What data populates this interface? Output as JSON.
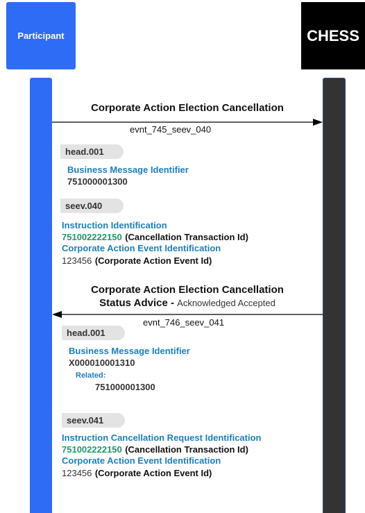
{
  "actors": {
    "participant": "Participant",
    "chess": "CHESS"
  },
  "message1": {
    "title": "Corporate Action Election Cancellation",
    "event": "evnt_745_seev_040",
    "head": {
      "tag": "head.001",
      "field": "Business Message Identifier",
      "value": "751000001300"
    },
    "body": {
      "tag": "seev.040",
      "f1": "Instruction Identification",
      "v1_id": "751002222150",
      "v1_note": "(Cancellation Transaction Id)",
      "f2": "Corporate Action Event Identification",
      "v2_id": "123456",
      "v2_note": "(Corporate Action Event Id)"
    }
  },
  "message2": {
    "title_line1": "Corporate Action Election Cancellation",
    "title_line2": "Status Advice -",
    "status": "Acknowledged Accepted",
    "event": "evnt_746_seev_041",
    "head": {
      "tag": "head.001",
      "field": "Business Message Identifier",
      "value": "X000010001310",
      "related_label": "Related:",
      "related_value": "751000001300"
    },
    "body": {
      "tag": "seev.041",
      "f1": "Instruction Cancellation Request Identification",
      "v1_id": "751002222150",
      "v1_note": "(Cancellation Transaction Id)",
      "f2": "Corporate Action Event Identification",
      "v2_id": "123456",
      "v2_note": "(Corporate Action Event Id)"
    }
  }
}
